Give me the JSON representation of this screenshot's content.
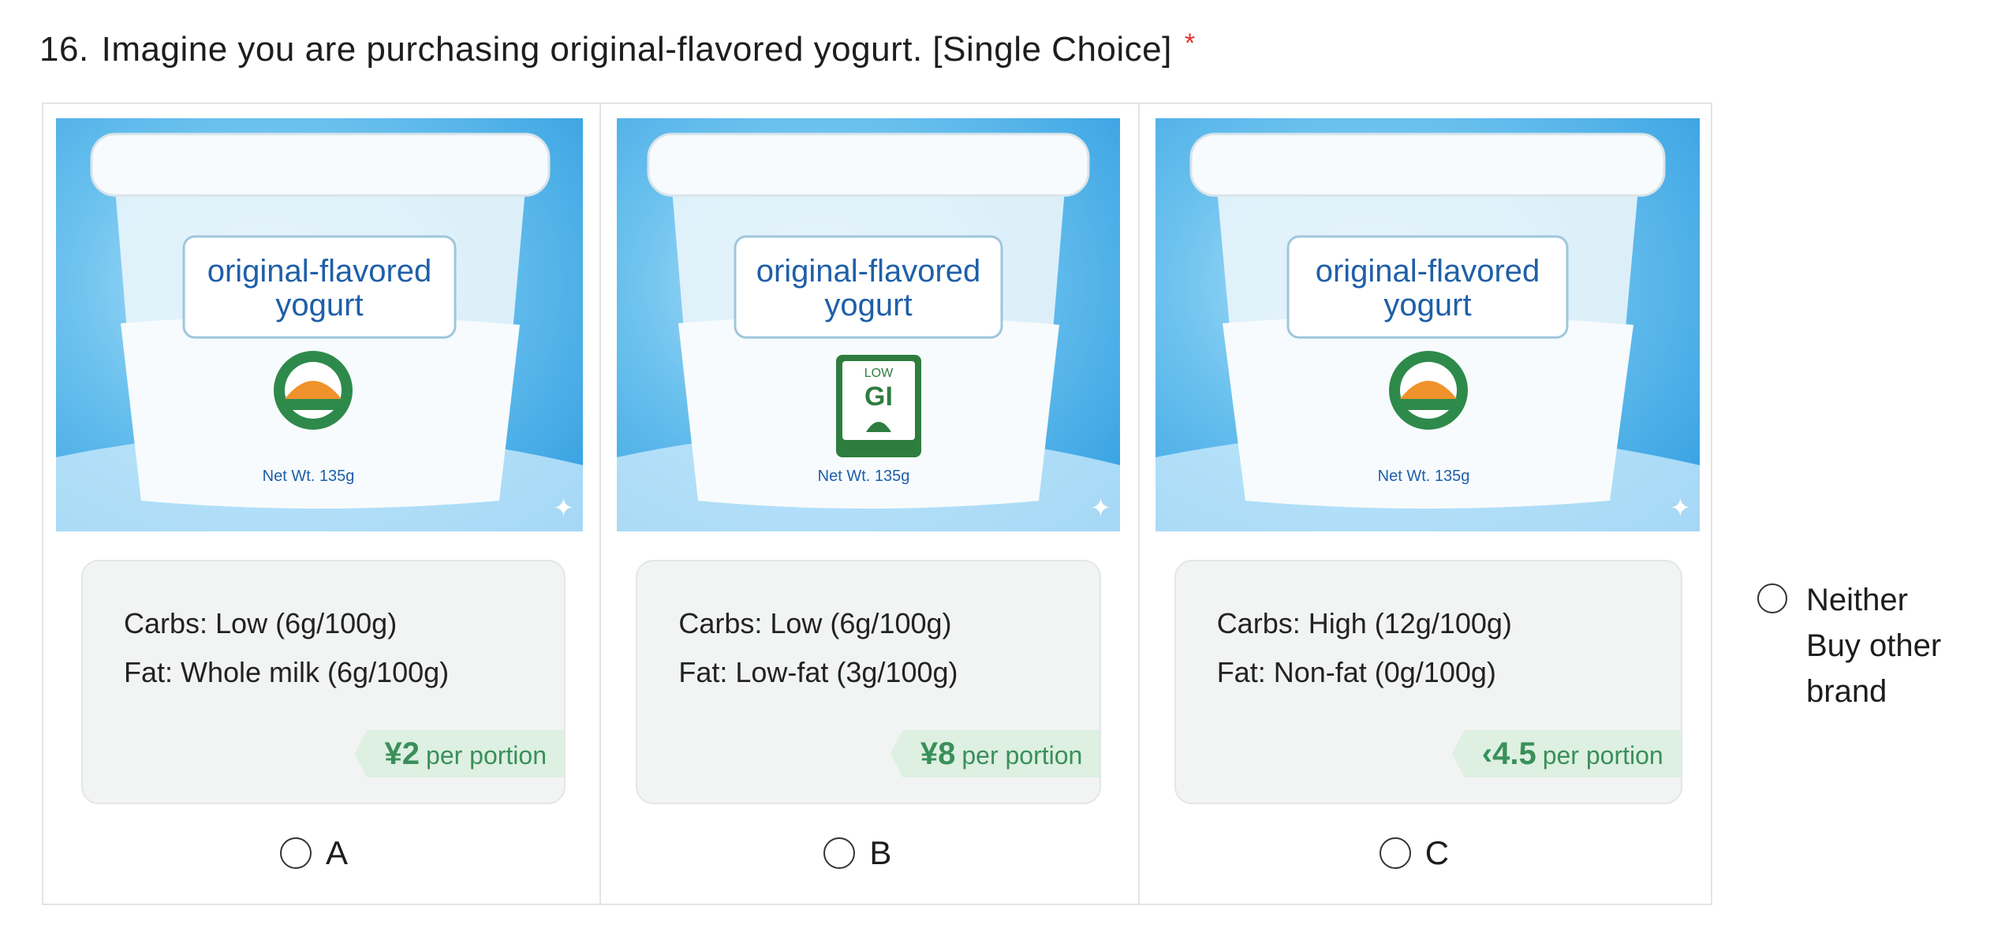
{
  "question": {
    "number": "16.",
    "text": "Imagine you are purchasing original-flavored yogurt. [Single Choice]",
    "required_marker": "*"
  },
  "options": [
    {
      "product_name_line1": "original-flavored",
      "product_name_line2": "yogurt",
      "net_weight": "Net Wt. 135g",
      "badge_icon": "organic-certification-icon",
      "carbs": "Carbs: Low (6g/100g)",
      "fat": "Fat: Whole milk (6g/100g)",
      "price": "¥2",
      "price_unit": "per portion",
      "label": "A"
    },
    {
      "product_name_line1": "original-flavored",
      "product_name_line2": "yogurt",
      "net_weight": "Net Wt. 135g",
      "badge_icon": "low-gi-certified-icon",
      "badge_text_top": "LOW",
      "badge_text_main": "GI",
      "carbs": "Carbs: Low (6g/100g)",
      "fat": "Fat: Low-fat (3g/100g)",
      "price": "¥8",
      "price_unit": "per portion",
      "label": "B"
    },
    {
      "product_name_line1": "original-flavored",
      "product_name_line2": "yogurt",
      "net_weight": "Net Wt. 135g",
      "badge_icon": "organic-certification-icon",
      "carbs": "Carbs: High (12g/100g)",
      "fat": "Fat: Non-fat (0g/100g)",
      "price": "‹4.5",
      "price_unit": "per portion",
      "label": "C"
    }
  ],
  "neither_option": {
    "line1": "Neither",
    "line2": "Buy other",
    "line3": "brand"
  },
  "colors": {
    "required": "#e0302d",
    "price_text": "#3a8f5a",
    "price_bg": "#ddf0e1",
    "image_bg": "#6bc1ee",
    "label_text": "#1f5fa8"
  }
}
